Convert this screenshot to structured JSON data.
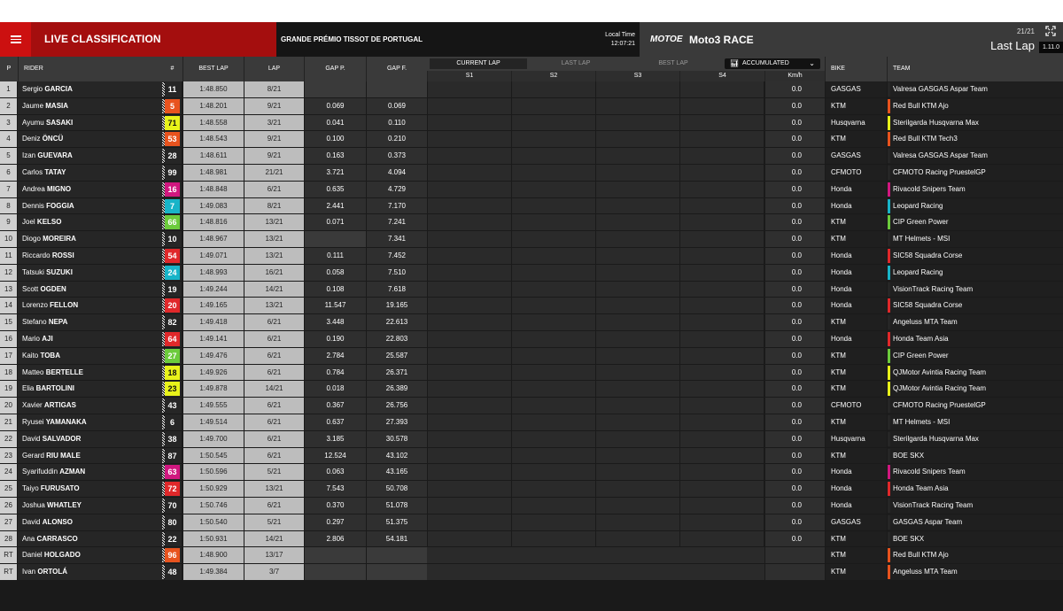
{
  "header": {
    "menu_icon": "hamburger-menu-icon",
    "title": "LIVE CLASSIFICATION",
    "event": "GRANDE PRÉMIO TISSOT DE PORTUGAL",
    "local_time_label": "Local Time",
    "local_time": "12:07:21",
    "logo": "MOTOE",
    "race": "Moto3 RACE",
    "lap_count": "21/21",
    "lap_label": "Last Lap",
    "version": "1.11.0",
    "expand_icon": "expand-icon"
  },
  "columns": {
    "pos": "P",
    "rider": "RIDER",
    "number": "#",
    "best_lap": "BEST LAP",
    "lap": "LAP",
    "gap_p": "GAP P.",
    "gap_f": "GAP F.",
    "bike": "BIKE",
    "team": "TEAM"
  },
  "sector_tabs": {
    "current_lap": "CURRENT LAP",
    "last_lap": "LAST LAP",
    "best_lap": "BEST LAP",
    "accumulated": "ACCUMULATED",
    "accumulated_icon": "bar-chart-icon",
    "chevron_icon": "chevron-down-icon",
    "s1": "S1",
    "s2": "S2",
    "s3": "S3",
    "s4": "S4",
    "kmh": "Km/h"
  },
  "colors": {
    "header_red": "#a40e0e",
    "menu_red": "#cc1010"
  },
  "riders": [
    {
      "pos": "1",
      "first": "Sergio",
      "last": "GARCIA",
      "num": "11",
      "num_bg": "#262626",
      "num_fg": "#ffffff",
      "best": "1:48.850",
      "lap": "8/21",
      "gap_p": "",
      "gap_f": "",
      "kmh": "0.0",
      "bike": "GASGAS",
      "team": "Valresa GASGAS Aspar Team",
      "team_color": "#262626"
    },
    {
      "pos": "2",
      "first": "Jaume",
      "last": "MASIA",
      "num": "5",
      "num_bg": "#e8531e",
      "num_fg": "#ffffff",
      "best": "1:48.201",
      "lap": "9/21",
      "gap_p": "0.069",
      "gap_f": "0.069",
      "kmh": "0.0",
      "bike": "KTM",
      "team": "Red Bull KTM Ajo",
      "team_color": "#e8531e"
    },
    {
      "pos": "3",
      "first": "Ayumu",
      "last": "SASAKI",
      "num": "71",
      "num_bg": "#e8f21a",
      "num_fg": "#111111",
      "best": "1:48.558",
      "lap": "3/21",
      "gap_p": "0.041",
      "gap_f": "0.110",
      "kmh": "0.0",
      "bike": "Husqvarna",
      "team": "Sterilgarda Husqvarna Max",
      "team_color": "#e8f21a"
    },
    {
      "pos": "4",
      "first": "Deniz",
      "last": "ÖNCÜ",
      "num": "53",
      "num_bg": "#e8531e",
      "num_fg": "#ffffff",
      "best": "1:48.543",
      "lap": "9/21",
      "gap_p": "0.100",
      "gap_f": "0.210",
      "kmh": "0.0",
      "bike": "KTM",
      "team": "Red Bull KTM Tech3",
      "team_color": "#e8531e"
    },
    {
      "pos": "5",
      "first": "Izan",
      "last": "GUEVARA",
      "num": "28",
      "num_bg": "#262626",
      "num_fg": "#ffffff",
      "best": "1:48.611",
      "lap": "9/21",
      "gap_p": "0.163",
      "gap_f": "0.373",
      "kmh": "0.0",
      "bike": "GASGAS",
      "team": "Valresa GASGAS Aspar Team",
      "team_color": "#262626"
    },
    {
      "pos": "6",
      "first": "Carlos",
      "last": "TATAY",
      "num": "99",
      "num_bg": "#262626",
      "num_fg": "#ffffff",
      "best": "1:48.981",
      "lap": "21/21",
      "gap_p": "3.721",
      "gap_f": "4.094",
      "kmh": "0.0",
      "bike": "CFMOTO",
      "team": "CFMOTO Racing PruestelGP",
      "team_color": "#262626"
    },
    {
      "pos": "7",
      "first": "Andrea",
      "last": "MIGNO",
      "num": "16",
      "num_bg": "#d0177f",
      "num_fg": "#ffffff",
      "best": "1:48.848",
      "lap": "6/21",
      "gap_p": "0.635",
      "gap_f": "4.729",
      "kmh": "0.0",
      "bike": "Honda",
      "team": "Rivacold Snipers Team",
      "team_color": "#d0177f"
    },
    {
      "pos": "8",
      "first": "Dennis",
      "last": "FOGGIA",
      "num": "7",
      "num_bg": "#18b4c8",
      "num_fg": "#ffffff",
      "best": "1:49.083",
      "lap": "8/21",
      "gap_p": "2.441",
      "gap_f": "7.170",
      "kmh": "0.0",
      "bike": "Honda",
      "team": "Leopard Racing",
      "team_color": "#18b4c8"
    },
    {
      "pos": "9",
      "first": "Joel",
      "last": "KELSO",
      "num": "66",
      "num_bg": "#6ccb3c",
      "num_fg": "#ffffff",
      "best": "1:48.816",
      "lap": "13/21",
      "gap_p": "0.071",
      "gap_f": "7.241",
      "kmh": "0.0",
      "bike": "KTM",
      "team": "CIP Green Power",
      "team_color": "#6ccb3c"
    },
    {
      "pos": "10",
      "first": "Diogo",
      "last": "MOREIRA",
      "num": "10",
      "num_bg": "#262626",
      "num_fg": "#ffffff",
      "best": "1:48.967",
      "lap": "13/21",
      "gap_p": "",
      "gap_f": "7.341",
      "kmh": "0.0",
      "bike": "KTM",
      "team": "MT Helmets - MSI",
      "team_color": "#262626"
    },
    {
      "pos": "11",
      "first": "Riccardo",
      "last": "ROSSI",
      "num": "54",
      "num_bg": "#e0282a",
      "num_fg": "#ffffff",
      "best": "1:49.071",
      "lap": "13/21",
      "gap_p": "0.111",
      "gap_f": "7.452",
      "kmh": "0.0",
      "bike": "Honda",
      "team": "SIC58 Squadra Corse",
      "team_color": "#e0282a"
    },
    {
      "pos": "12",
      "first": "Tatsuki",
      "last": "SUZUKI",
      "num": "24",
      "num_bg": "#18b4c8",
      "num_fg": "#ffffff",
      "best": "1:48.993",
      "lap": "16/21",
      "gap_p": "0.058",
      "gap_f": "7.510",
      "kmh": "0.0",
      "bike": "Honda",
      "team": "Leopard Racing",
      "team_color": "#18b4c8"
    },
    {
      "pos": "13",
      "first": "Scott",
      "last": "OGDEN",
      "num": "19",
      "num_bg": "#262626",
      "num_fg": "#ffffff",
      "best": "1:49.244",
      "lap": "14/21",
      "gap_p": "0.108",
      "gap_f": "7.618",
      "kmh": "0.0",
      "bike": "Honda",
      "team": "VisionTrack Racing Team",
      "team_color": "#262626"
    },
    {
      "pos": "14",
      "first": "Lorenzo",
      "last": "FELLON",
      "num": "20",
      "num_bg": "#e0282a",
      "num_fg": "#ffffff",
      "best": "1:49.165",
      "lap": "13/21",
      "gap_p": "11.547",
      "gap_f": "19.165",
      "kmh": "0.0",
      "bike": "Honda",
      "team": "SIC58 Squadra Corse",
      "team_color": "#e0282a"
    },
    {
      "pos": "15",
      "first": "Stefano",
      "last": "NEPA",
      "num": "82",
      "num_bg": "#262626",
      "num_fg": "#ffffff",
      "best": "1:49.418",
      "lap": "6/21",
      "gap_p": "3.448",
      "gap_f": "22.613",
      "kmh": "0.0",
      "bike": "KTM",
      "team": "Angeluss MTA Team",
      "team_color": "#262626"
    },
    {
      "pos": "16",
      "first": "Mario",
      "last": "AJI",
      "num": "64",
      "num_bg": "#e0282a",
      "num_fg": "#ffffff",
      "best": "1:49.141",
      "lap": "6/21",
      "gap_p": "0.190",
      "gap_f": "22.803",
      "kmh": "0.0",
      "bike": "Honda",
      "team": "Honda Team Asia",
      "team_color": "#e0282a"
    },
    {
      "pos": "17",
      "first": "Kaito",
      "last": "TOBA",
      "num": "27",
      "num_bg": "#6ccb3c",
      "num_fg": "#ffffff",
      "best": "1:49.476",
      "lap": "6/21",
      "gap_p": "2.784",
      "gap_f": "25.587",
      "kmh": "0.0",
      "bike": "KTM",
      "team": "CIP Green Power",
      "team_color": "#6ccb3c"
    },
    {
      "pos": "18",
      "first": "Matteo",
      "last": "BERTELLE",
      "num": "18",
      "num_bg": "#e8f21a",
      "num_fg": "#111111",
      "best": "1:49.926",
      "lap": "6/21",
      "gap_p": "0.784",
      "gap_f": "26.371",
      "kmh": "0.0",
      "bike": "KTM",
      "team": "QJMotor Avintia Racing Team",
      "team_color": "#e8f21a"
    },
    {
      "pos": "19",
      "first": "Elia",
      "last": "BARTOLINI",
      "num": "23",
      "num_bg": "#e8f21a",
      "num_fg": "#111111",
      "best": "1:49.878",
      "lap": "14/21",
      "gap_p": "0.018",
      "gap_f": "26.389",
      "kmh": "0.0",
      "bike": "KTM",
      "team": "QJMotor Avintia Racing Team",
      "team_color": "#e8f21a"
    },
    {
      "pos": "20",
      "first": "Xavier",
      "last": "ARTIGAS",
      "num": "43",
      "num_bg": "#262626",
      "num_fg": "#ffffff",
      "best": "1:49.555",
      "lap": "6/21",
      "gap_p": "0.367",
      "gap_f": "26.756",
      "kmh": "0.0",
      "bike": "CFMOTO",
      "team": "CFMOTO Racing PruestelGP",
      "team_color": "#262626"
    },
    {
      "pos": "21",
      "first": "Ryusei",
      "last": "YAMANAKA",
      "num": "6",
      "num_bg": "#262626",
      "num_fg": "#ffffff",
      "best": "1:49.514",
      "lap": "6/21",
      "gap_p": "0.637",
      "gap_f": "27.393",
      "kmh": "0.0",
      "bike": "KTM",
      "team": "MT Helmets - MSI",
      "team_color": "#262626"
    },
    {
      "pos": "22",
      "first": "David",
      "last": "SALVADOR",
      "num": "38",
      "num_bg": "#262626",
      "num_fg": "#ffffff",
      "best": "1:49.700",
      "lap": "6/21",
      "gap_p": "3.185",
      "gap_f": "30.578",
      "kmh": "0.0",
      "bike": "Husqvarna",
      "team": "Sterilgarda Husqvarna Max",
      "team_color": "#262626"
    },
    {
      "pos": "23",
      "first": "Gerard",
      "last": "RIU MALE",
      "num": "87",
      "num_bg": "#262626",
      "num_fg": "#ffffff",
      "best": "1:50.545",
      "lap": "6/21",
      "gap_p": "12.524",
      "gap_f": "43.102",
      "kmh": "0.0",
      "bike": "KTM",
      "team": "BOE SKX",
      "team_color": "#262626"
    },
    {
      "pos": "24",
      "first": "Syarifuddin",
      "last": "AZMAN",
      "num": "63",
      "num_bg": "#d0177f",
      "num_fg": "#ffffff",
      "best": "1:50.596",
      "lap": "5/21",
      "gap_p": "0.063",
      "gap_f": "43.165",
      "kmh": "0.0",
      "bike": "Honda",
      "team": "Rivacold Snipers Team",
      "team_color": "#d0177f"
    },
    {
      "pos": "25",
      "first": "Taiyo",
      "last": "FURUSATO",
      "num": "72",
      "num_bg": "#e0282a",
      "num_fg": "#ffffff",
      "best": "1:50.929",
      "lap": "13/21",
      "gap_p": "7.543",
      "gap_f": "50.708",
      "kmh": "0.0",
      "bike": "Honda",
      "team": "Honda Team Asia",
      "team_color": "#e0282a"
    },
    {
      "pos": "26",
      "first": "Joshua",
      "last": "WHATLEY",
      "num": "70",
      "num_bg": "#262626",
      "num_fg": "#ffffff",
      "best": "1:50.746",
      "lap": "6/21",
      "gap_p": "0.370",
      "gap_f": "51.078",
      "kmh": "0.0",
      "bike": "Honda",
      "team": "VisionTrack Racing Team",
      "team_color": "#262626"
    },
    {
      "pos": "27",
      "first": "David",
      "last": "ALONSO",
      "num": "80",
      "num_bg": "#262626",
      "num_fg": "#ffffff",
      "best": "1:50.540",
      "lap": "5/21",
      "gap_p": "0.297",
      "gap_f": "51.375",
      "kmh": "0.0",
      "bike": "GASGAS",
      "team": "GASGAS Aspar Team",
      "team_color": "#262626"
    },
    {
      "pos": "28",
      "first": "Ana",
      "last": "CARRASCO",
      "num": "22",
      "num_bg": "#262626",
      "num_fg": "#ffffff",
      "best": "1:50.931",
      "lap": "14/21",
      "gap_p": "2.806",
      "gap_f": "54.181",
      "kmh": "0.0",
      "bike": "KTM",
      "team": "BOE SKX",
      "team_color": "#262626"
    },
    {
      "pos": "RT",
      "first": "Daniel",
      "last": "HOLGADO",
      "num": "96",
      "num_bg": "#e8531e",
      "num_fg": "#ffffff",
      "best": "1:48.900",
      "lap": "13/17",
      "gap_p": "",
      "gap_f": "",
      "kmh": "",
      "bike": "KTM",
      "team": "Red Bull KTM Ajo",
      "team_color": "#e8531e"
    },
    {
      "pos": "RT",
      "first": "Ivan",
      "last": "ORTOLÁ",
      "num": "48",
      "num_bg": "#262626",
      "num_fg": "#ffffff",
      "best": "1:49.384",
      "lap": "3/7",
      "gap_p": "",
      "gap_f": "",
      "kmh": "",
      "bike": "KTM",
      "team": "Angeluss MTA Team",
      "team_color": "#e8531e"
    }
  ]
}
